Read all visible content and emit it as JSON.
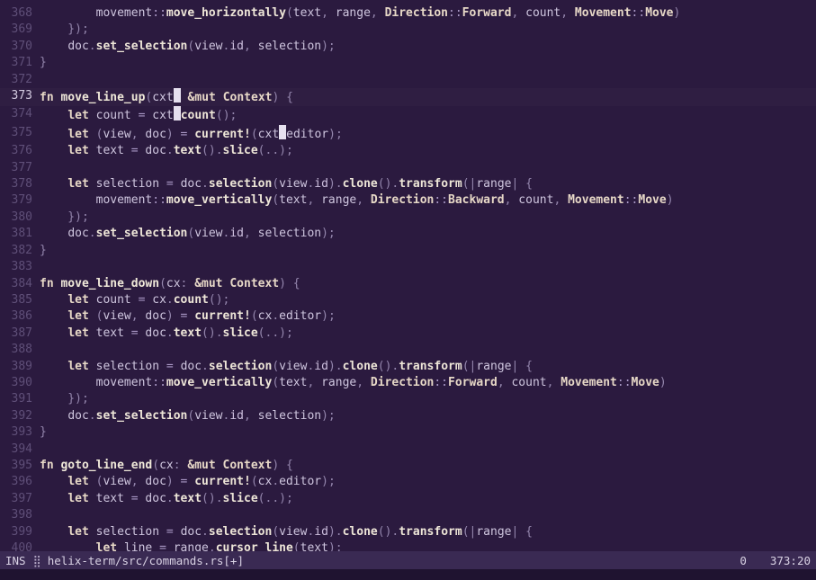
{
  "statusbar": {
    "mode": "INS",
    "spinner": "⣿",
    "filepath": "helix-term/src/commands.rs[+]",
    "diag_count": "0",
    "position": "373:20"
  },
  "first_line_no": 368,
  "current_line_no": 373,
  "cursors": [
    {
      "line": 373,
      "col_after_text": "fn move_line_up(cxt"
    },
    {
      "line": 374,
      "col_after_text": "    let count = cxt"
    },
    {
      "line": 375,
      "col_after_text": "    let (view, doc) = current!(cxt"
    }
  ],
  "lines": [
    {
      "n": 368,
      "seg": [
        [
          "punc",
          "        "
        ],
        [
          "ident",
          "movement"
        ],
        [
          "path",
          "::"
        ],
        [
          "call",
          "move_horizontally"
        ],
        [
          "punc",
          "("
        ],
        [
          "ident",
          "text"
        ],
        [
          "punc",
          ", "
        ],
        [
          "ident",
          "range"
        ],
        [
          "punc",
          ", "
        ],
        [
          "ty",
          "Direction"
        ],
        [
          "path",
          "::"
        ],
        [
          "enumv",
          "Forward"
        ],
        [
          "punc",
          ", "
        ],
        [
          "ident",
          "count"
        ],
        [
          "punc",
          ", "
        ],
        [
          "ty",
          "Movement"
        ],
        [
          "path",
          "::"
        ],
        [
          "enumv",
          "Move"
        ],
        [
          "punc",
          ")"
        ]
      ]
    },
    {
      "n": 369,
      "seg": [
        [
          "punc",
          "    });"
        ]
      ]
    },
    {
      "n": 370,
      "seg": [
        [
          "punc",
          "    "
        ],
        [
          "ident",
          "doc"
        ],
        [
          "punc",
          "."
        ],
        [
          "call",
          "set_selection"
        ],
        [
          "punc",
          "("
        ],
        [
          "ident",
          "view"
        ],
        [
          "punc",
          "."
        ],
        [
          "field",
          "id"
        ],
        [
          "punc",
          ", "
        ],
        [
          "ident",
          "selection"
        ],
        [
          "punc",
          ");"
        ]
      ]
    },
    {
      "n": 371,
      "seg": [
        [
          "punc",
          "}"
        ]
      ]
    },
    {
      "n": 372,
      "seg": []
    },
    {
      "n": 373,
      "seg": [
        [
          "kw",
          "fn "
        ],
        [
          "fnname",
          "move_line_up"
        ],
        [
          "punc",
          "("
        ],
        [
          "ident",
          "cxt"
        ],
        [
          "CURSOR",
          ""
        ],
        [
          "punc",
          " "
        ],
        [
          "kw",
          "&mut "
        ],
        [
          "ty",
          "Context"
        ],
        [
          "punc",
          ") {"
        ]
      ]
    },
    {
      "n": 374,
      "seg": [
        [
          "punc",
          "    "
        ],
        [
          "kw",
          "let "
        ],
        [
          "ident",
          "count"
        ],
        [
          "op",
          " = "
        ],
        [
          "ident",
          "cxt"
        ],
        [
          "CURSOR",
          ""
        ],
        [
          "call",
          "count"
        ],
        [
          "punc",
          "();"
        ]
      ]
    },
    {
      "n": 375,
      "seg": [
        [
          "punc",
          "    "
        ],
        [
          "kw",
          "let "
        ],
        [
          "punc",
          "("
        ],
        [
          "ident",
          "view"
        ],
        [
          "punc",
          ", "
        ],
        [
          "ident",
          "doc"
        ],
        [
          "punc",
          ")"
        ],
        [
          "op",
          " = "
        ],
        [
          "macro",
          "current!"
        ],
        [
          "punc",
          "("
        ],
        [
          "ident",
          "cxt"
        ],
        [
          "CURSOR",
          ""
        ],
        [
          "ident",
          "editor"
        ],
        [
          "punc",
          ");"
        ]
      ]
    },
    {
      "n": 376,
      "seg": [
        [
          "punc",
          "    "
        ],
        [
          "kw",
          "let "
        ],
        [
          "ident",
          "text"
        ],
        [
          "op",
          " = "
        ],
        [
          "ident",
          "doc"
        ],
        [
          "punc",
          "."
        ],
        [
          "call",
          "text"
        ],
        [
          "punc",
          "()."
        ],
        [
          "call",
          "slice"
        ],
        [
          "punc",
          "(..);"
        ]
      ]
    },
    {
      "n": 377,
      "seg": []
    },
    {
      "n": 378,
      "seg": [
        [
          "punc",
          "    "
        ],
        [
          "kw",
          "let "
        ],
        [
          "ident",
          "selection"
        ],
        [
          "op",
          " = "
        ],
        [
          "ident",
          "doc"
        ],
        [
          "punc",
          "."
        ],
        [
          "call",
          "selection"
        ],
        [
          "punc",
          "("
        ],
        [
          "ident",
          "view"
        ],
        [
          "punc",
          "."
        ],
        [
          "field",
          "id"
        ],
        [
          "punc",
          ")."
        ],
        [
          "call",
          "clone"
        ],
        [
          "punc",
          "()."
        ],
        [
          "call",
          "transform"
        ],
        [
          "punc",
          "(|"
        ],
        [
          "ident",
          "range"
        ],
        [
          "punc",
          "| {"
        ]
      ]
    },
    {
      "n": 379,
      "seg": [
        [
          "punc",
          "        "
        ],
        [
          "ident",
          "movement"
        ],
        [
          "path",
          "::"
        ],
        [
          "call",
          "move_vertically"
        ],
        [
          "punc",
          "("
        ],
        [
          "ident",
          "text"
        ],
        [
          "punc",
          ", "
        ],
        [
          "ident",
          "range"
        ],
        [
          "punc",
          ", "
        ],
        [
          "ty",
          "Direction"
        ],
        [
          "path",
          "::"
        ],
        [
          "enumv",
          "Backward"
        ],
        [
          "punc",
          ", "
        ],
        [
          "ident",
          "count"
        ],
        [
          "punc",
          ", "
        ],
        [
          "ty",
          "Movement"
        ],
        [
          "path",
          "::"
        ],
        [
          "enumv",
          "Move"
        ],
        [
          "punc",
          ")"
        ]
      ]
    },
    {
      "n": 380,
      "seg": [
        [
          "punc",
          "    });"
        ]
      ]
    },
    {
      "n": 381,
      "seg": [
        [
          "punc",
          "    "
        ],
        [
          "ident",
          "doc"
        ],
        [
          "punc",
          "."
        ],
        [
          "call",
          "set_selection"
        ],
        [
          "punc",
          "("
        ],
        [
          "ident",
          "view"
        ],
        [
          "punc",
          "."
        ],
        [
          "field",
          "id"
        ],
        [
          "punc",
          ", "
        ],
        [
          "ident",
          "selection"
        ],
        [
          "punc",
          ");"
        ]
      ]
    },
    {
      "n": 382,
      "seg": [
        [
          "punc",
          "}"
        ]
      ]
    },
    {
      "n": 383,
      "seg": []
    },
    {
      "n": 384,
      "seg": [
        [
          "kw",
          "fn "
        ],
        [
          "fnname",
          "move_line_down"
        ],
        [
          "punc",
          "("
        ],
        [
          "ident",
          "cx"
        ],
        [
          "punc",
          ": "
        ],
        [
          "kw",
          "&mut "
        ],
        [
          "ty",
          "Context"
        ],
        [
          "punc",
          ") {"
        ]
      ]
    },
    {
      "n": 385,
      "seg": [
        [
          "punc",
          "    "
        ],
        [
          "kw",
          "let "
        ],
        [
          "ident",
          "count"
        ],
        [
          "op",
          " = "
        ],
        [
          "ident",
          "cx"
        ],
        [
          "punc",
          "."
        ],
        [
          "call",
          "count"
        ],
        [
          "punc",
          "();"
        ]
      ]
    },
    {
      "n": 386,
      "seg": [
        [
          "punc",
          "    "
        ],
        [
          "kw",
          "let "
        ],
        [
          "punc",
          "("
        ],
        [
          "ident",
          "view"
        ],
        [
          "punc",
          ", "
        ],
        [
          "ident",
          "doc"
        ],
        [
          "punc",
          ")"
        ],
        [
          "op",
          " = "
        ],
        [
          "macro",
          "current!"
        ],
        [
          "punc",
          "("
        ],
        [
          "ident",
          "cx"
        ],
        [
          "punc",
          "."
        ],
        [
          "ident",
          "editor"
        ],
        [
          "punc",
          ");"
        ]
      ]
    },
    {
      "n": 387,
      "seg": [
        [
          "punc",
          "    "
        ],
        [
          "kw",
          "let "
        ],
        [
          "ident",
          "text"
        ],
        [
          "op",
          " = "
        ],
        [
          "ident",
          "doc"
        ],
        [
          "punc",
          "."
        ],
        [
          "call",
          "text"
        ],
        [
          "punc",
          "()."
        ],
        [
          "call",
          "slice"
        ],
        [
          "punc",
          "(..);"
        ]
      ]
    },
    {
      "n": 388,
      "seg": []
    },
    {
      "n": 389,
      "seg": [
        [
          "punc",
          "    "
        ],
        [
          "kw",
          "let "
        ],
        [
          "ident",
          "selection"
        ],
        [
          "op",
          " = "
        ],
        [
          "ident",
          "doc"
        ],
        [
          "punc",
          "."
        ],
        [
          "call",
          "selection"
        ],
        [
          "punc",
          "("
        ],
        [
          "ident",
          "view"
        ],
        [
          "punc",
          "."
        ],
        [
          "field",
          "id"
        ],
        [
          "punc",
          ")."
        ],
        [
          "call",
          "clone"
        ],
        [
          "punc",
          "()."
        ],
        [
          "call",
          "transform"
        ],
        [
          "punc",
          "(|"
        ],
        [
          "ident",
          "range"
        ],
        [
          "punc",
          "| {"
        ]
      ]
    },
    {
      "n": 390,
      "seg": [
        [
          "punc",
          "        "
        ],
        [
          "ident",
          "movement"
        ],
        [
          "path",
          "::"
        ],
        [
          "call",
          "move_vertically"
        ],
        [
          "punc",
          "("
        ],
        [
          "ident",
          "text"
        ],
        [
          "punc",
          ", "
        ],
        [
          "ident",
          "range"
        ],
        [
          "punc",
          ", "
        ],
        [
          "ty",
          "Direction"
        ],
        [
          "path",
          "::"
        ],
        [
          "enumv",
          "Forward"
        ],
        [
          "punc",
          ", "
        ],
        [
          "ident",
          "count"
        ],
        [
          "punc",
          ", "
        ],
        [
          "ty",
          "Movement"
        ],
        [
          "path",
          "::"
        ],
        [
          "enumv",
          "Move"
        ],
        [
          "punc",
          ")"
        ]
      ]
    },
    {
      "n": 391,
      "seg": [
        [
          "punc",
          "    });"
        ]
      ]
    },
    {
      "n": 392,
      "seg": [
        [
          "punc",
          "    "
        ],
        [
          "ident",
          "doc"
        ],
        [
          "punc",
          "."
        ],
        [
          "call",
          "set_selection"
        ],
        [
          "punc",
          "("
        ],
        [
          "ident",
          "view"
        ],
        [
          "punc",
          "."
        ],
        [
          "field",
          "id"
        ],
        [
          "punc",
          ", "
        ],
        [
          "ident",
          "selection"
        ],
        [
          "punc",
          ");"
        ]
      ]
    },
    {
      "n": 393,
      "seg": [
        [
          "punc",
          "}"
        ]
      ]
    },
    {
      "n": 394,
      "seg": []
    },
    {
      "n": 395,
      "seg": [
        [
          "kw",
          "fn "
        ],
        [
          "fnname",
          "goto_line_end"
        ],
        [
          "punc",
          "("
        ],
        [
          "ident",
          "cx"
        ],
        [
          "punc",
          ": "
        ],
        [
          "kw",
          "&mut "
        ],
        [
          "ty",
          "Context"
        ],
        [
          "punc",
          ") {"
        ]
      ]
    },
    {
      "n": 396,
      "seg": [
        [
          "punc",
          "    "
        ],
        [
          "kw",
          "let "
        ],
        [
          "punc",
          "("
        ],
        [
          "ident",
          "view"
        ],
        [
          "punc",
          ", "
        ],
        [
          "ident",
          "doc"
        ],
        [
          "punc",
          ")"
        ],
        [
          "op",
          " = "
        ],
        [
          "macro",
          "current!"
        ],
        [
          "punc",
          "("
        ],
        [
          "ident",
          "cx"
        ],
        [
          "punc",
          "."
        ],
        [
          "ident",
          "editor"
        ],
        [
          "punc",
          ");"
        ]
      ]
    },
    {
      "n": 397,
      "seg": [
        [
          "punc",
          "    "
        ],
        [
          "kw",
          "let "
        ],
        [
          "ident",
          "text"
        ],
        [
          "op",
          " = "
        ],
        [
          "ident",
          "doc"
        ],
        [
          "punc",
          "."
        ],
        [
          "call",
          "text"
        ],
        [
          "punc",
          "()."
        ],
        [
          "call",
          "slice"
        ],
        [
          "punc",
          "(..);"
        ]
      ]
    },
    {
      "n": 398,
      "seg": []
    },
    {
      "n": 399,
      "seg": [
        [
          "punc",
          "    "
        ],
        [
          "kw",
          "let "
        ],
        [
          "ident",
          "selection"
        ],
        [
          "op",
          " = "
        ],
        [
          "ident",
          "doc"
        ],
        [
          "punc",
          "."
        ],
        [
          "call",
          "selection"
        ],
        [
          "punc",
          "("
        ],
        [
          "ident",
          "view"
        ],
        [
          "punc",
          "."
        ],
        [
          "field",
          "id"
        ],
        [
          "punc",
          ")."
        ],
        [
          "call",
          "clone"
        ],
        [
          "punc",
          "()."
        ],
        [
          "call",
          "transform"
        ],
        [
          "punc",
          "(|"
        ],
        [
          "ident",
          "range"
        ],
        [
          "punc",
          "| {"
        ]
      ]
    },
    {
      "n": 400,
      "seg": [
        [
          "punc",
          "        "
        ],
        [
          "kw",
          "let "
        ],
        [
          "ident",
          "line"
        ],
        [
          "op",
          " = "
        ],
        [
          "ident",
          "range"
        ],
        [
          "punc",
          "."
        ],
        [
          "call",
          "cursor_line"
        ],
        [
          "punc",
          "("
        ],
        [
          "ident",
          "text"
        ],
        [
          "punc",
          ");"
        ]
      ]
    }
  ]
}
